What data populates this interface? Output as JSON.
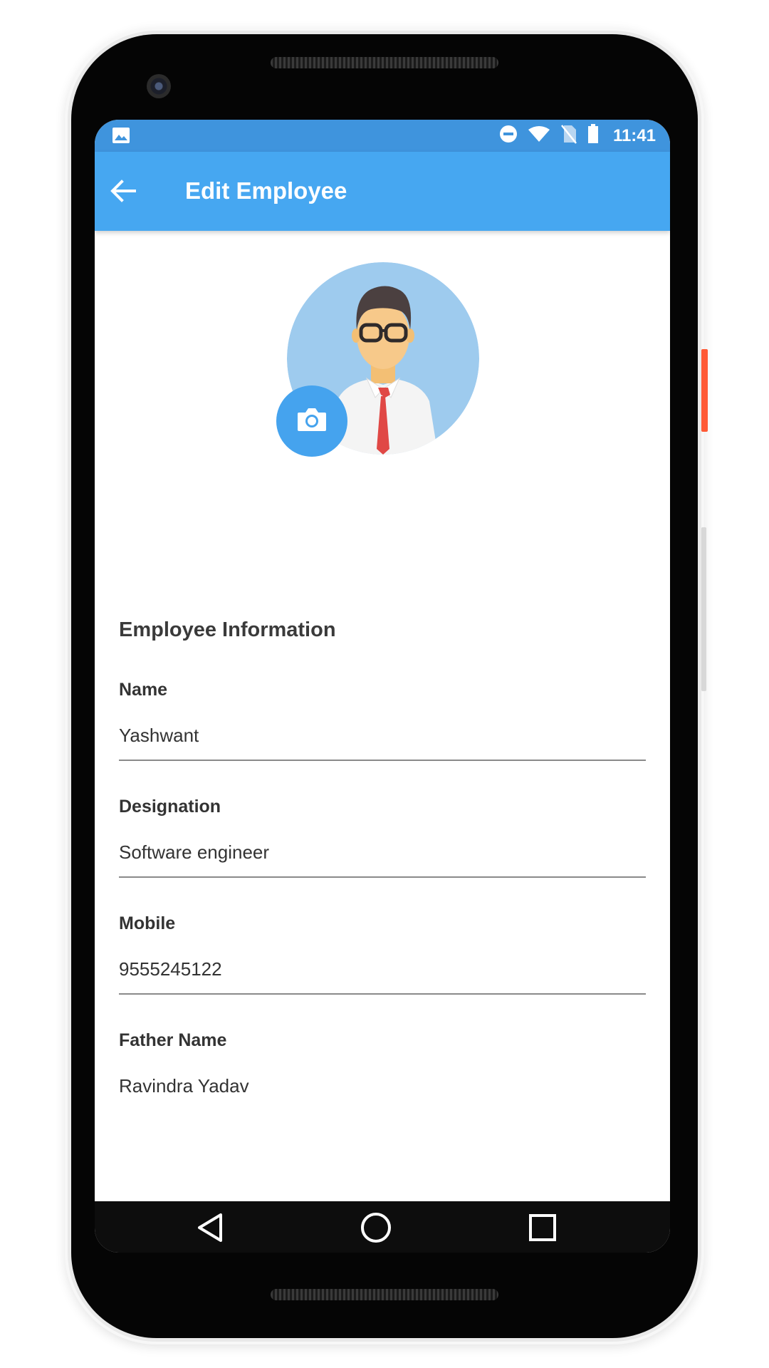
{
  "status_bar": {
    "time": "11:41",
    "icons": [
      "image-icon",
      "do-not-disturb-icon",
      "wifi-icon",
      "no-sim-icon",
      "battery-icon"
    ]
  },
  "app_bar": {
    "title": "Edit Employee",
    "back_icon": "arrow-back-icon",
    "color": "#46a7f1"
  },
  "profile": {
    "avatar": "employee-avatar-illustration",
    "camera_icon": "camera-icon"
  },
  "form": {
    "section_title": "Employee Information",
    "fields": [
      {
        "label": "Name",
        "value": "Yashwant"
      },
      {
        "label": "Designation",
        "value": "Software engineer"
      },
      {
        "label": "Mobile",
        "value": "9555245122"
      },
      {
        "label": "Father Name",
        "value": "Ravindra Yadav"
      }
    ]
  },
  "nav_bar": {
    "buttons": [
      "back-triangle-icon",
      "home-circle-icon",
      "recents-square-icon"
    ]
  },
  "colors": {
    "status_bar": "#3f94dd",
    "accent": "#46a7f1",
    "camera_button": "#45a3ee"
  }
}
